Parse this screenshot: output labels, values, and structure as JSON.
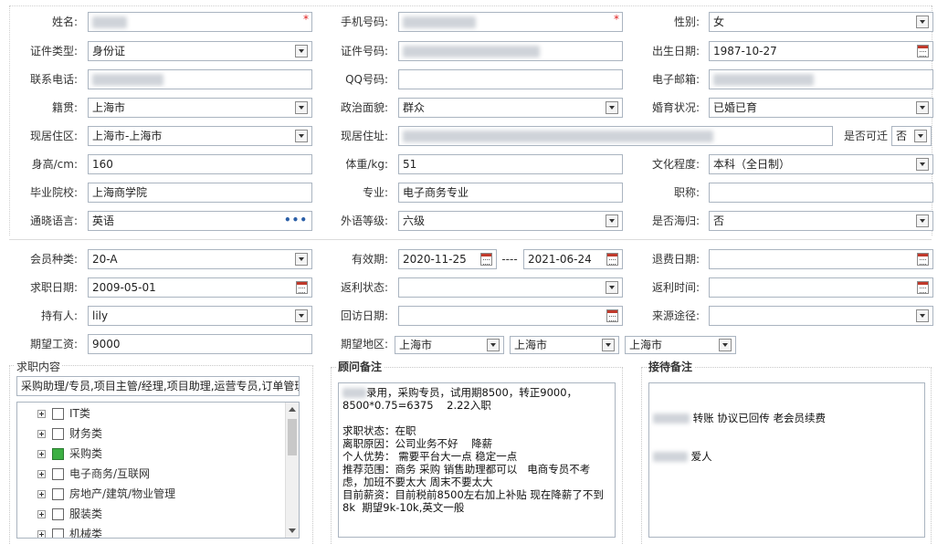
{
  "form": {
    "name": {
      "label": "姓名:",
      "value": ""
    },
    "phone": {
      "label": "手机号码:",
      "value": ""
    },
    "gender": {
      "label": "性别:",
      "value": "女"
    },
    "id_type": {
      "label": "证件类型:",
      "value": "身份证"
    },
    "id_no": {
      "label": "证件号码:",
      "value": ""
    },
    "birth": {
      "label": "出生日期:",
      "value": "1987-10-27"
    },
    "contact_phone": {
      "label": "联系电话:",
      "value": ""
    },
    "qq": {
      "label": "QQ号码:",
      "value": ""
    },
    "email": {
      "label": "电子邮箱:",
      "value": ""
    },
    "native": {
      "label": "籍贯:",
      "value": "上海市"
    },
    "political": {
      "label": "政治面貌:",
      "value": "群众"
    },
    "marital": {
      "label": "婚育状况:",
      "value": "已婚已育"
    },
    "live_area": {
      "label": "现居住区:",
      "value": "上海市-上海市"
    },
    "live_addr": {
      "label": "现居住址:",
      "value": ""
    },
    "relocate": {
      "label": "是否可迁",
      "value": "否"
    },
    "height": {
      "label": "身高/cm:",
      "value": "160"
    },
    "weight": {
      "label": "体重/kg:",
      "value": "51"
    },
    "education": {
      "label": "文化程度:",
      "value": "本科（全日制）"
    },
    "school": {
      "label": "毕业院校:",
      "value": "上海商学院"
    },
    "major": {
      "label": "专业:",
      "value": "电子商务专业"
    },
    "title": {
      "label": "职称:",
      "value": ""
    },
    "language": {
      "label": "通晓语言:",
      "value": "英语"
    },
    "foreign_level": {
      "label": "外语等级:",
      "value": "六级"
    },
    "overseas": {
      "label": "是否海归:",
      "value": "否"
    }
  },
  "membership": {
    "member_type": {
      "label": "会员种类:",
      "value": "20-A"
    },
    "valid": {
      "label": "有效期:",
      "from": "2020-11-25",
      "sep": "----",
      "to": "2021-06-24"
    },
    "refund_date": {
      "label": "退费日期:",
      "value": ""
    },
    "job_date": {
      "label": "求职日期:",
      "value": "2009-05-01"
    },
    "rebate_status": {
      "label": "返利状态:",
      "value": ""
    },
    "rebate_time": {
      "label": "返利时间:",
      "value": ""
    },
    "holder": {
      "label": "持有人:",
      "value": "lily"
    },
    "visit_date": {
      "label": "回访日期:",
      "value": ""
    },
    "source": {
      "label": "来源途径:",
      "value": ""
    },
    "salary": {
      "label": "期望工资:",
      "value": "9000"
    },
    "region": {
      "label": "期望地区:",
      "values": [
        "上海市",
        "上海市",
        "上海市"
      ]
    }
  },
  "job_content": {
    "title": "求职内容",
    "summary": "采购助理/专员,项目主管/经理,项目助理,运营专员,订单管理",
    "tree": [
      {
        "label": "IT类",
        "checked": false
      },
      {
        "label": "财务类",
        "checked": false
      },
      {
        "label": "采购类",
        "checked": true
      },
      {
        "label": "电子商务/互联网",
        "checked": false
      },
      {
        "label": "房地产/建筑/物业管理",
        "checked": false
      },
      {
        "label": "服装类",
        "checked": false
      },
      {
        "label": "机械类",
        "checked": false
      }
    ]
  },
  "advisor_note": {
    "title": "顾问备注",
    "text": "录用，采购专员，试用期8500，转正9000，\n8500*0.75=6375    2.22入职\n\n求职状态：在职\n离职原因：公司业务不好    降薪\n个人优势： 需要平台大一点 稳定一点\n推荐范围：商务 采购 销售助理都可以   电商专员不考虑，加班不要太大 周末不要太大\n目前薪资：目前税前8500左右加上补贴 现在降薪了不到8k  期望9k-10k,英文一般"
  },
  "reception_note": {
    "title": "接待备注",
    "line1": "转账 协议已回传 老会员续费",
    "line2": "爱人"
  },
  "colors": {
    "required": "#e02020",
    "checked": "#3cb043",
    "border": "#aab4c0"
  }
}
